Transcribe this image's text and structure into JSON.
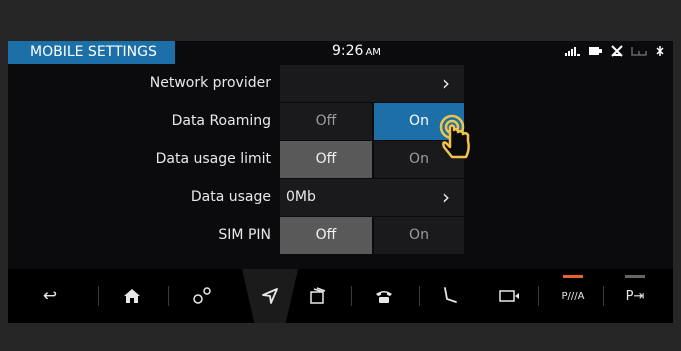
{
  "header": {
    "title": "MOBILE SETTINGS",
    "time": "9:26",
    "ampm": "AM",
    "status_icons": [
      "signal-icon",
      "battery-icon",
      "no-phone-icon",
      "seat-icon",
      "bluetooth-icon"
    ]
  },
  "rows": [
    {
      "label": "Network provider",
      "value": "",
      "type": "link"
    },
    {
      "label": "Data Roaming",
      "options": [
        "Off",
        "On"
      ],
      "selected": "On"
    },
    {
      "label": "Data usage limit",
      "options": [
        "Off",
        "On"
      ],
      "selected": "Off"
    },
    {
      "label": "Data usage",
      "value": "0Mb",
      "type": "link"
    },
    {
      "label": "SIM PIN",
      "options": [
        "Off",
        "On"
      ],
      "selected": "Off"
    }
  ],
  "chevron": "›",
  "nav": {
    "items": [
      "back-icon",
      "home-icon",
      "connected-icon",
      "navigation-icon",
      "media-icon",
      "phone-icon",
      "seat-icon",
      "camera-icon",
      "parking-icon",
      "pop-out-icon"
    ],
    "parking_label": "P///A",
    "back_glyph": "↩",
    "home_glyph": "⌂",
    "connected_glyph": "ºº",
    "nav_glyph": "➤",
    "media_glyph": "♫",
    "phone_glyph": "☎",
    "seat_glyph": "⌇",
    "camera_glyph": "▭",
    "popout_glyph": "P⇥"
  },
  "colors": {
    "accent": "#1d6fa8",
    "selected_gray": "#595959",
    "orange": "#e8622c",
    "hand": "#f2c34a"
  }
}
